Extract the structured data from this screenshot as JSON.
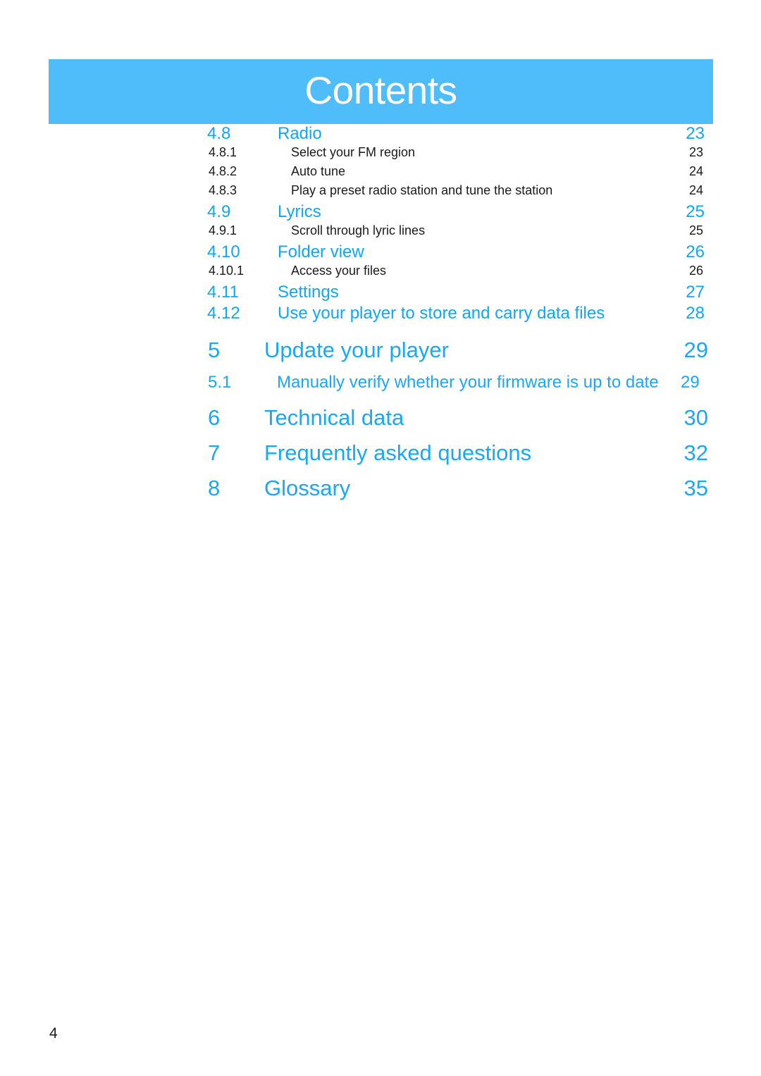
{
  "document": {
    "title": "Contents",
    "footer_page_number": "4"
  },
  "colors": {
    "banner_background": "#4FBDF9",
    "banner_title_text": "#FFFFFF",
    "heading_blue": "#0FA7F5",
    "body_black": "#1A1A1A",
    "page_background": "#FFFFFF"
  },
  "toc": {
    "entries": [
      {
        "level": 1,
        "number": "4.8",
        "label": "Radio",
        "page": "23"
      },
      {
        "level": 2,
        "number": "4.8.1",
        "label": "Select your FM region",
        "page": "23"
      },
      {
        "level": 2,
        "number": "4.8.2",
        "label": "Auto tune",
        "page": "24"
      },
      {
        "level": 2,
        "number": "4.8.3",
        "label": "Play a preset radio station and tune the station",
        "page": "24"
      },
      {
        "level": 1,
        "number": "4.9",
        "label": "Lyrics",
        "page": "25"
      },
      {
        "level": 2,
        "number": "4.9.1",
        "label": "Scroll through lyric lines",
        "page": "25"
      },
      {
        "level": 1,
        "number": "4.10",
        "label": "Folder view",
        "page": "26"
      },
      {
        "level": 2,
        "number": "4.10.1",
        "label": "Access your files",
        "page": "26"
      },
      {
        "level": 1,
        "number": "4.11",
        "label": "Settings",
        "page": "27"
      },
      {
        "level": 1,
        "number": "4.12",
        "label": "Use your player to store and carry data files",
        "page": "28"
      },
      {
        "level": 0,
        "number": "5",
        "label": "Update your player",
        "page": "29"
      },
      {
        "level": 0.5,
        "number": "5.1",
        "label": "Manually verify whether your firmware is up to date",
        "page": "29"
      },
      {
        "level": 0,
        "number": "6",
        "label": "Technical data",
        "page": "30"
      },
      {
        "level": 0,
        "number": "7",
        "label": "Frequently asked questions",
        "page": "32"
      },
      {
        "level": 0,
        "number": "8",
        "label": "Glossary",
        "page": "35"
      }
    ]
  }
}
